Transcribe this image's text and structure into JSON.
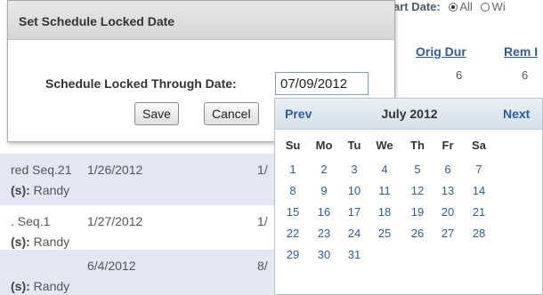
{
  "background": {
    "filter_label": "art Date:",
    "filter_option_all": "All",
    "filter_option_other": "Wi",
    "columns": [
      {
        "header": "Orig Dur",
        "value": "6"
      },
      {
        "header": "Rem I",
        "value": "6"
      }
    ],
    "rows": [
      {
        "name": "red Seq.21",
        "date": "1/26/2012",
        "end": "1/",
        "owner_label": "(s):",
        "owner": "Randy",
        "shaded": true
      },
      {
        "name": ". Seq.1",
        "date": "1/27/2012",
        "end": "1/",
        "owner_label": "(s):",
        "owner": "Randy",
        "shaded": false
      },
      {
        "name": "",
        "date": "6/4/2012",
        "end": "8/",
        "owner_label": "(s):",
        "owner": "Randy",
        "shaded": true
      }
    ]
  },
  "dialog": {
    "title": "Set Schedule Locked Date",
    "label": "Schedule Locked Through Date:",
    "date_value": "07/09/2012",
    "save_label": "Save",
    "cancel_label": "Cancel"
  },
  "datepicker": {
    "prev_label": "Prev",
    "next_label": "Next",
    "month_label": "July 2012",
    "weekdays": [
      "Su",
      "Mo",
      "Tu",
      "We",
      "Th",
      "Fr",
      "Sa"
    ],
    "weeks": [
      [
        "1",
        "2",
        "3",
        "4",
        "5",
        "6",
        "7"
      ],
      [
        "8",
        "9",
        "10",
        "11",
        "12",
        "13",
        "14"
      ],
      [
        "15",
        "16",
        "17",
        "18",
        "19",
        "20",
        "21"
      ],
      [
        "22",
        "23",
        "24",
        "25",
        "26",
        "27",
        "28"
      ],
      [
        "29",
        "30",
        "31",
        "",
        "",
        "",
        ""
      ]
    ]
  }
}
